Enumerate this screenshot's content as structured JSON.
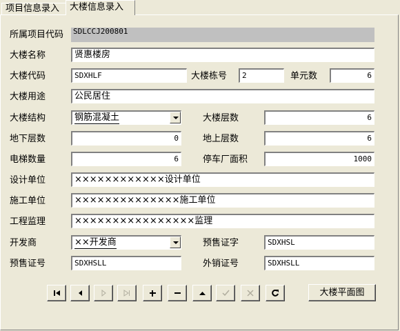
{
  "tabs": [
    {
      "label": "项目信息录入"
    },
    {
      "label": "大楼信息录入"
    }
  ],
  "form": {
    "project_code": {
      "label": "所属项目代码",
      "value": "SDLCCJ200801"
    },
    "building_name": {
      "label": "大楼名称",
      "value": "贤惠楼房"
    },
    "building_code": {
      "label": "大楼代码",
      "value": "SDXHLF"
    },
    "building_number": {
      "label": "大楼栋号",
      "value": "2"
    },
    "unit_count": {
      "label": "单元数",
      "value": "6"
    },
    "building_use": {
      "label": "大楼用途",
      "value": "公民居住"
    },
    "structure": {
      "label": "大楼结构",
      "value": "钢筋混凝土"
    },
    "floors": {
      "label": "大楼层数",
      "value": "6"
    },
    "underground_floors": {
      "label": "地下层数",
      "value": "0"
    },
    "above_floors": {
      "label": "地上层数",
      "value": "6"
    },
    "elevators": {
      "label": "电梯数量",
      "value": "6"
    },
    "parking_area": {
      "label": "停车厂面积",
      "value": "1000"
    },
    "design_unit": {
      "label": "设计单位",
      "value": "××××××××××××设计单位"
    },
    "construction_unit": {
      "label": "施工单位",
      "value": "××××××××××××××施工单位"
    },
    "supervision": {
      "label": "工程监理",
      "value": "××××××××××××××××监理"
    },
    "developer": {
      "label": "开发商",
      "value": "××开发商"
    },
    "presale_permit": {
      "label": "预售证字",
      "value": "SDXHSL"
    },
    "presale_cert": {
      "label": "预售证号",
      "value": "SDXHSLL"
    },
    "external_sales_cert": {
      "label": "外销证号",
      "value": "SDXHSLL"
    }
  },
  "buttons": {
    "floor_plan": "大楼平面图"
  },
  "nav_icons": [
    "first-record-icon",
    "prev-record-icon",
    "next-record-icon",
    "last-record-icon",
    "insert-record-icon",
    "delete-record-icon",
    "edit-record-icon",
    "post-record-icon",
    "cancel-record-icon",
    "refresh-icon"
  ]
}
